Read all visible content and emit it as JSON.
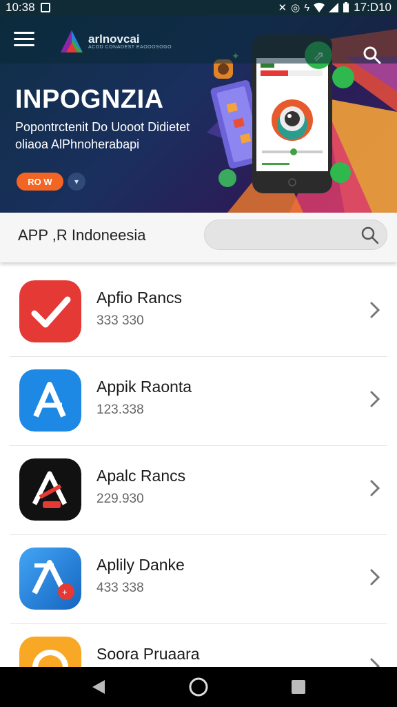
{
  "status_bar": {
    "time_left": "10:38",
    "time_right": "17:D10",
    "icons": [
      "image-icon",
      "mute-icon",
      "alarm-icon",
      "bluetooth-icon",
      "wifi-icon",
      "signal-icon",
      "battery-icon"
    ]
  },
  "header": {
    "logo_text": "arlnovcai",
    "logo_sub": "ACOD CONADEST EAOOOSOGO"
  },
  "hero": {
    "title": "INPOGNZIA",
    "subtitle_line1": "Popontrctenit Do Uooot Didietet",
    "subtitle_line2": "oliaoa AlPhnoherabapi",
    "primary_button": "RO W",
    "secondary_button": "▾"
  },
  "search_band": {
    "title": "APP ,R Indoneesia",
    "placeholder": ""
  },
  "apps": [
    {
      "name": "Apfio Rancs",
      "meta": "333 330",
      "icon": "red-check-icon",
      "color": "#e53935"
    },
    {
      "name": "Appik Raonta",
      "meta": "123.338",
      "icon": "blue-a-icon",
      "color": "#1e88e5"
    },
    {
      "name": "Apalc Rancs",
      "meta": "229.930",
      "icon": "black-a-icon",
      "color": "#111111"
    },
    {
      "name": "Aplily Danke",
      "meta": "433 338",
      "icon": "blue-gradient-a-icon",
      "color": "#1976d2"
    },
    {
      "name": "Soora Pruaara",
      "meta": "",
      "icon": "yellow-circle-icon",
      "color": "#f9a825"
    }
  ],
  "colors": {
    "accent": "#f26522",
    "hero_bg": "#1a2f5e",
    "nav_bg": "#000000"
  }
}
